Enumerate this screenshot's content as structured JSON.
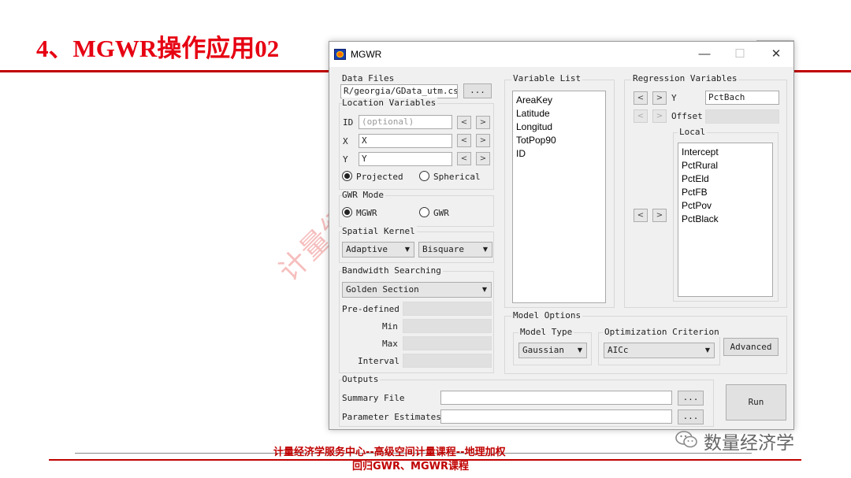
{
  "slide": {
    "title": "4、MGWR操作应用02",
    "watermark": "计量经济学服务中心",
    "footer_line1": "计量经济学服务中心--高级空间计量课程--地理加权",
    "footer_line2": "回归GWR、MGWR课程",
    "wechat_label": "数量经济学"
  },
  "window": {
    "title": "MGWR",
    "minimize": "—",
    "maximize": "☐",
    "close": "✕"
  },
  "data_files": {
    "label": "Data Files",
    "path": "R/georgia/GData_utm.csv",
    "browse": "..."
  },
  "location": {
    "label": "Location Variables",
    "id_label": "ID",
    "id_placeholder": "(optional)",
    "x_label": "X",
    "x_value": "X",
    "y_label": "Y",
    "y_value": "Y",
    "projected": "Projected",
    "spherical": "Spherical",
    "selected": "Projected"
  },
  "gwr_mode": {
    "label": "GWR Mode",
    "mgwr": "MGWR",
    "gwr": "GWR",
    "selected": "MGWR"
  },
  "kernel": {
    "label": "Spatial Kernel",
    "type": "Adaptive",
    "function": "Bisquare"
  },
  "bandwidth": {
    "label": "Bandwidth Searching",
    "method": "Golden Section",
    "predefined": "Pre-defined",
    "min": "Min",
    "max": "Max",
    "interval": "Interval"
  },
  "variable_list": {
    "label": "Variable List",
    "items": [
      "AreaKey",
      "Latitude",
      "Longitud",
      "TotPop90",
      "ID"
    ]
  },
  "regression": {
    "label": "Regression Variables",
    "y_label": "Y",
    "y_value": "PctBach",
    "offset_label": "Offset",
    "local_label": "Local",
    "local_items": [
      "Intercept",
      "PctRural",
      "PctEld",
      "PctFB",
      "PctPov",
      "PctBlack"
    ]
  },
  "model_options": {
    "label": "Model Options",
    "model_type_label": "Model Type",
    "model_type": "Gaussian",
    "criterion_label": "Optimization Criterion",
    "criterion": "AICc",
    "advanced": "Advanced"
  },
  "outputs": {
    "label": "Outputs",
    "summary_label": "Summary File",
    "params_label": "Parameter Estimates",
    "browse": "..."
  },
  "run_label": "Run",
  "icons": {
    "left_arrow": "<",
    "right_arrow": ">",
    "dropdown": "▼"
  }
}
